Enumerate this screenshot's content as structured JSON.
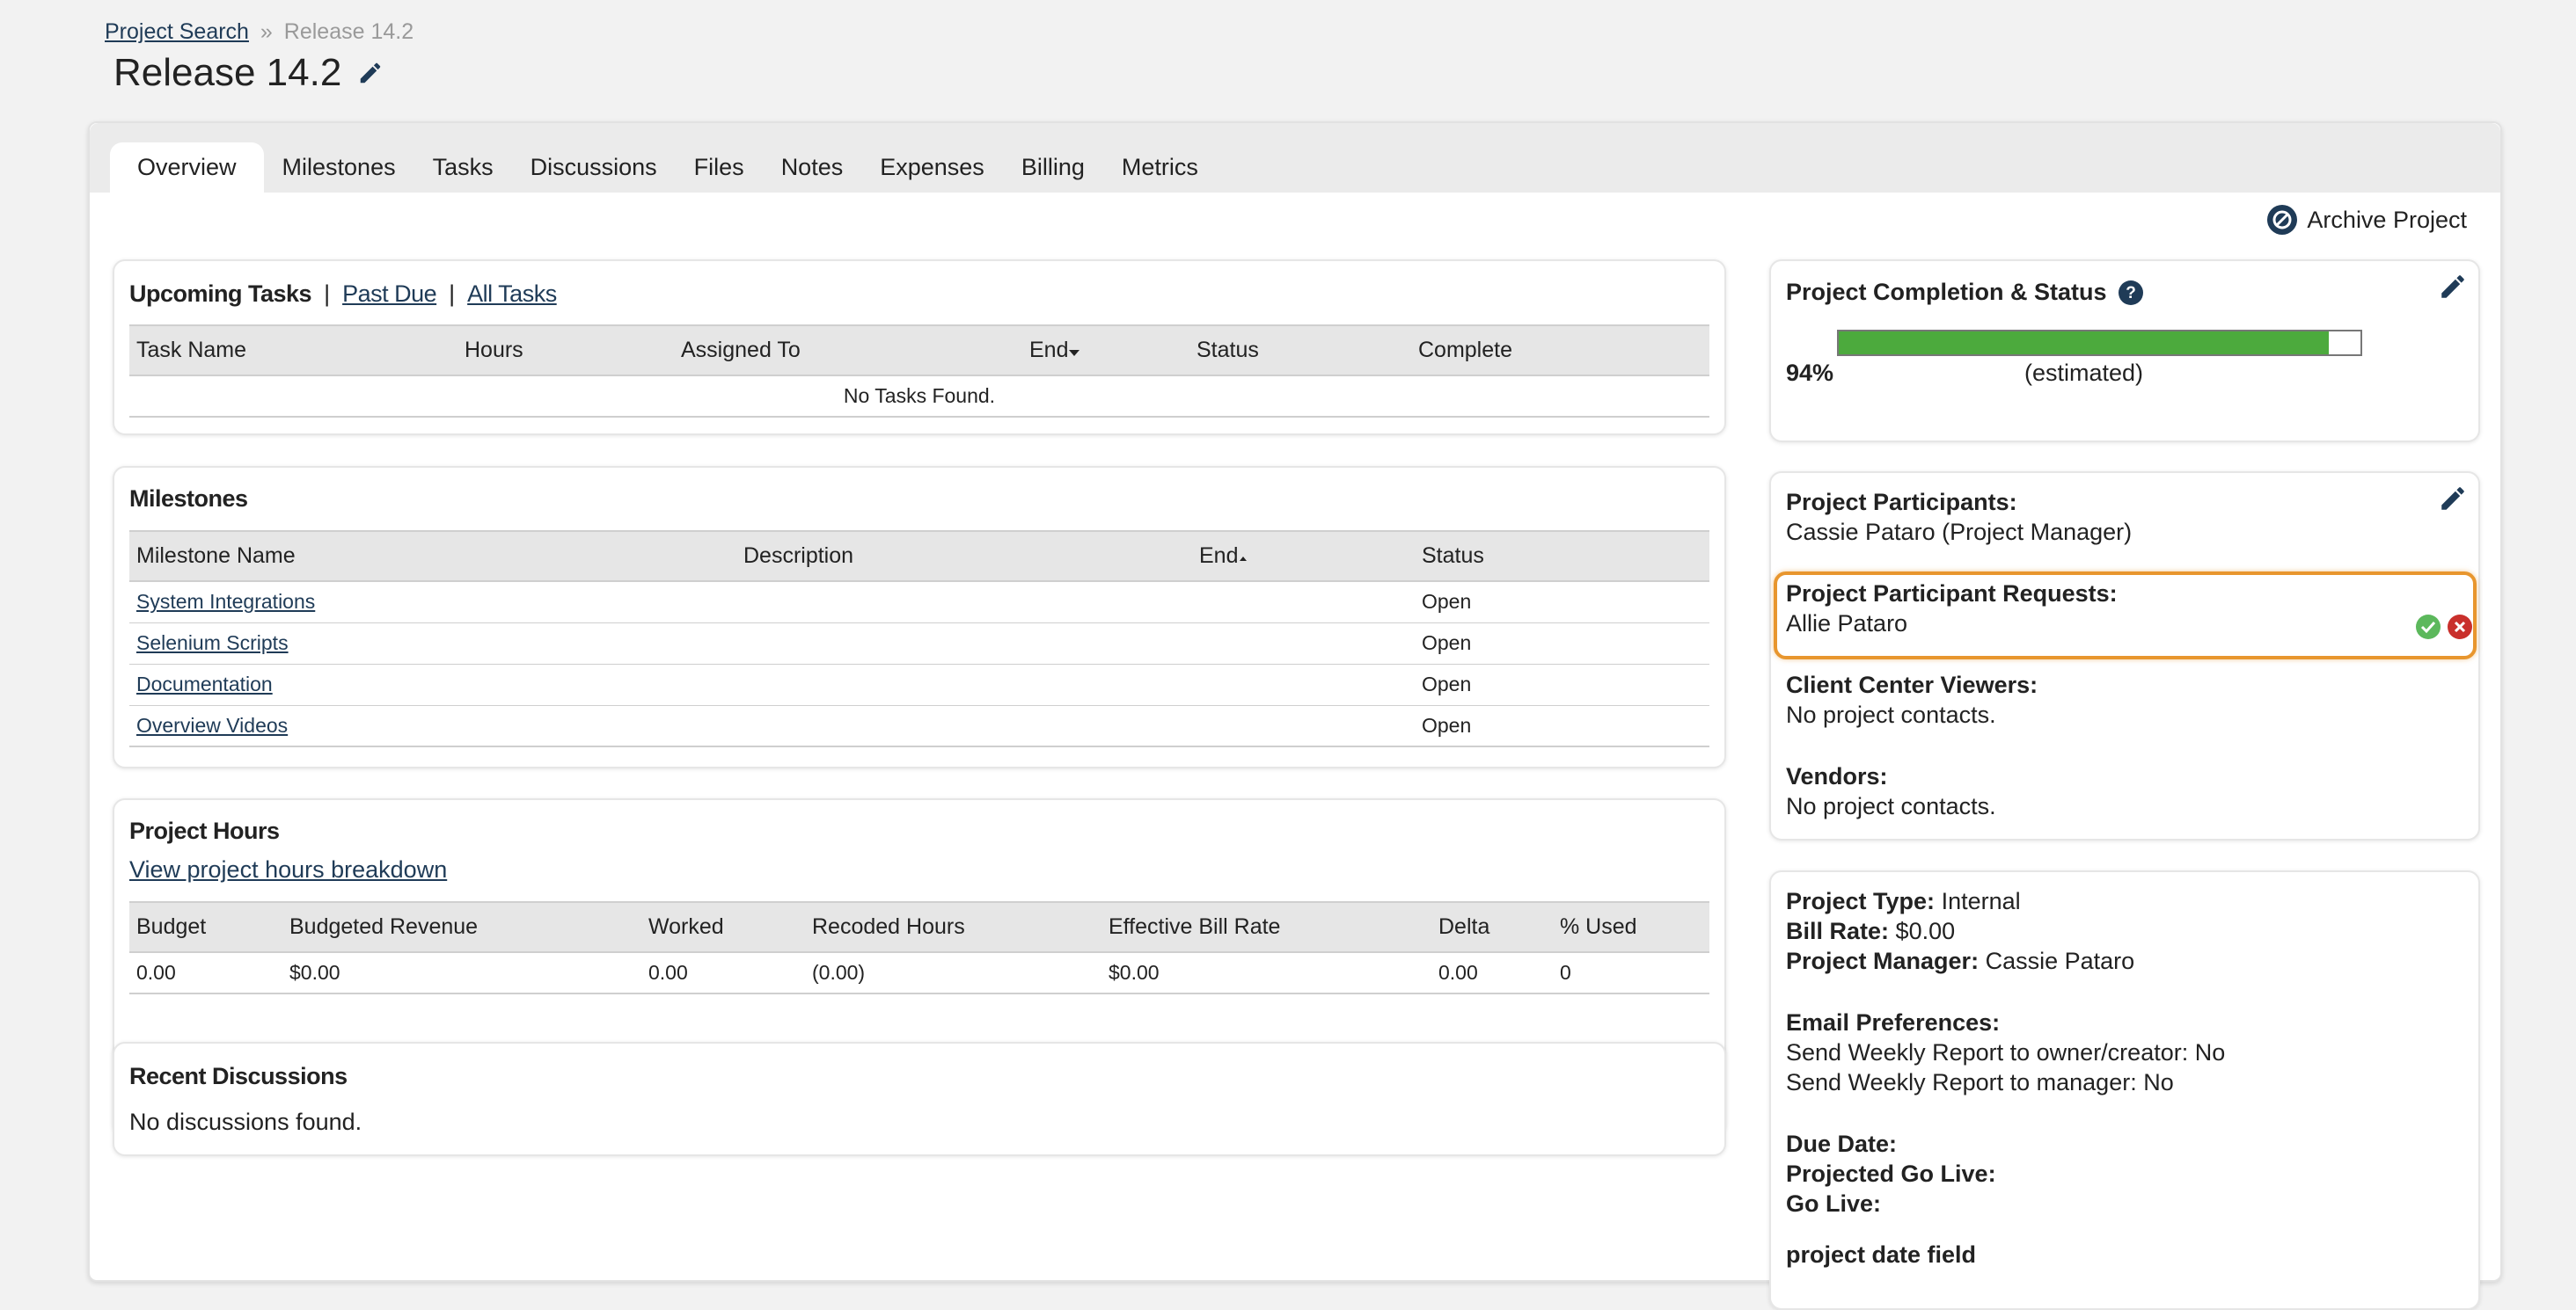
{
  "breadcrumb": {
    "root": "Project Search",
    "separator": "»",
    "current": "Release 14.2"
  },
  "title": "Release 14.2",
  "tabs": [
    "Overview",
    "Milestones",
    "Tasks",
    "Discussions",
    "Files",
    "Notes",
    "Expenses",
    "Billing",
    "Metrics"
  ],
  "archive_label": "Archive Project",
  "tasks": {
    "title": "Upcoming Tasks",
    "past_due": "Past Due",
    "all_tasks": "All Tasks",
    "divider": "|",
    "headers": [
      "Task Name",
      "Hours",
      "Assigned To",
      "End",
      "Status",
      "Complete"
    ],
    "empty": "No Tasks Found."
  },
  "milestones": {
    "title": "Milestones",
    "headers": [
      "Milestone Name",
      "Description",
      "End",
      "Status"
    ],
    "rows": [
      {
        "name": "System Integrations",
        "description": "",
        "end": "",
        "status": "Open"
      },
      {
        "name": "Selenium Scripts",
        "description": "",
        "end": "",
        "status": "Open"
      },
      {
        "name": "Documentation",
        "description": "",
        "end": "",
        "status": "Open"
      },
      {
        "name": "Overview Videos",
        "description": "",
        "end": "",
        "status": "Open"
      }
    ]
  },
  "hours": {
    "title": "Project Hours",
    "link": "View project hours breakdown",
    "headers": [
      "Budget",
      "Budgeted Revenue",
      "Worked",
      "Recoded Hours",
      "Effective Bill Rate",
      "Delta",
      "% Used"
    ],
    "row": [
      "0.00",
      "$0.00",
      "0.00",
      "(0.00)",
      "$0.00",
      "0.00",
      "0"
    ]
  },
  "discussions": {
    "title": "Recent Discussions",
    "empty": "No discussions found."
  },
  "completion": {
    "title": "Project Completion & Status",
    "percent_label": "94%",
    "percent": 0.94,
    "note": "(estimated)"
  },
  "participants": {
    "participants_label": "Project Participants:",
    "participants_value": "Cassie Pataro (Project Manager)",
    "requests_label": "Project Participant Requests:",
    "requests_value": "Allie Pataro",
    "viewers_label": "Client Center Viewers:",
    "viewers_value": "No project contacts.",
    "vendors_label": "Vendors:",
    "vendors_value": "No project contacts."
  },
  "details": {
    "type_label": "Project Type:",
    "type_value": "Internal",
    "rate_label": "Bill Rate:",
    "rate_value": "$0.00",
    "manager_label": "Project Manager:",
    "manager_value": "Cassie Pataro",
    "email_label": "Email Preferences:",
    "email_owner": "Send Weekly Report to owner/creator: No",
    "email_manager": "Send Weekly Report to manager: No",
    "due_label": "Due Date:",
    "projected_label": "Projected Go Live:",
    "golive_label": "Go Live:",
    "custom_label": "project date field"
  },
  "colors": {
    "progress": "#4caa3d",
    "request_highlight": "#e8962e",
    "approve": "#5cb85c",
    "reject": "#c9302c",
    "link": "#1f3b57"
  },
  "icons": [
    "pencil-icon",
    "archive-icon",
    "help-icon",
    "approve-icon",
    "reject-icon",
    "sort-down-icon",
    "sort-up-icon"
  ]
}
